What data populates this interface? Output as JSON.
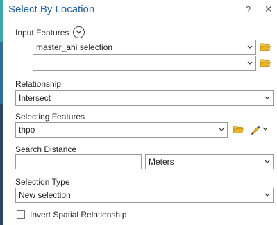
{
  "dialog": {
    "title": "Select By Location",
    "help_glyph": "?",
    "close_glyph": "✕"
  },
  "input_features": {
    "label": "Input Features",
    "rows": [
      {
        "value": "master_ahi selection"
      },
      {
        "value": ""
      }
    ]
  },
  "relationship": {
    "label": "Relationship",
    "value": "Intersect"
  },
  "selecting_features": {
    "label": "Selecting Features",
    "value": "thpo"
  },
  "search_distance": {
    "label": "Search Distance",
    "value": "",
    "unit": "Meters"
  },
  "selection_type": {
    "label": "Selection Type",
    "value": "New selection"
  },
  "invert": {
    "label": "Invert Spatial Relationship",
    "checked": false
  },
  "colors": {
    "title": "#1f5fa8",
    "folder": "#e8b428",
    "background": "#2f4a63"
  },
  "icons": [
    "chevron-down-icon",
    "folder-icon",
    "pencil-icon",
    "expand-circle-icon",
    "close-icon",
    "help-icon"
  ]
}
